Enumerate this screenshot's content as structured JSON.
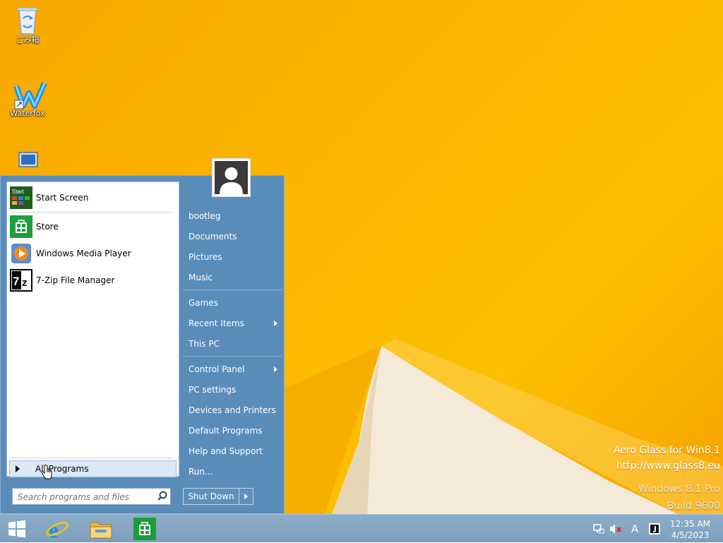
{
  "desktop": {
    "icons": [
      {
        "label": "ごみ箱",
        "icon": "recycle-bin-icon"
      },
      {
        "label": "Waterfox",
        "icon": "waterfox-icon"
      },
      {
        "label": "",
        "icon": "computer-icon"
      }
    ],
    "watermark": {
      "line1": "Aero Glass for Win8.1",
      "line2": "http://www.glass8.eu",
      "line3": "Windows 8.1 Pro",
      "line4": "Build 9600"
    }
  },
  "start_menu": {
    "pinned": [
      {
        "label": "Start Screen",
        "icon": "start-screen-icon"
      },
      {
        "label": "Store",
        "icon": "store-icon"
      },
      {
        "label": "Windows Media Player",
        "icon": "media-player-icon"
      },
      {
        "label": "7-Zip File Manager",
        "icon": "7zip-icon"
      }
    ],
    "all_programs": "All Programs",
    "search_placeholder": "Search programs and files",
    "right_items": [
      {
        "label": "bootleg"
      },
      {
        "label": "Documents"
      },
      {
        "label": "Pictures"
      },
      {
        "label": "Music"
      },
      {
        "label": "Games"
      },
      {
        "label": "Recent Items",
        "submenu": true
      },
      {
        "label": "This PC"
      },
      {
        "label": "Control Panel",
        "submenu": true
      },
      {
        "label": "PC settings"
      },
      {
        "label": "Devices and Printers"
      },
      {
        "label": "Default Programs"
      },
      {
        "label": "Help and Support"
      },
      {
        "label": "Run..."
      }
    ],
    "shutdown_label": "Shut Down"
  },
  "taskbar": {
    "pinned": [
      "start-button",
      "internet-explorer-icon",
      "file-explorer-icon",
      "store-icon"
    ],
    "tray_icons": [
      "network-icon",
      "volume-muted-icon",
      "ime-icon",
      "app-tray-icon"
    ],
    "time": "12:35 AM",
    "date": "4/5/2023"
  },
  "colors": {
    "menu_blue": "#5a8cba",
    "wallpaper": "#fbb400"
  }
}
